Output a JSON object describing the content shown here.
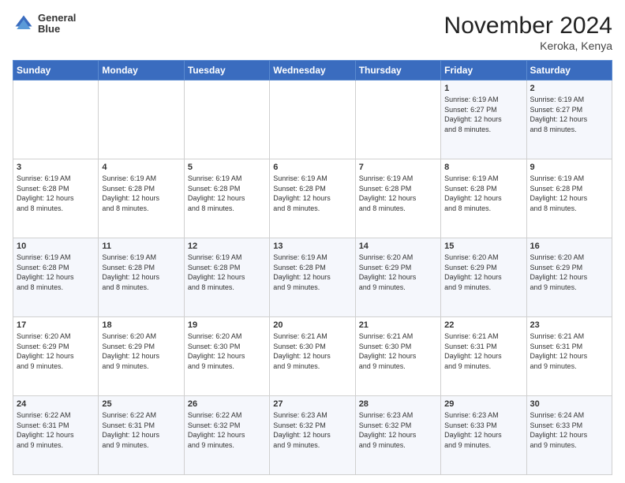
{
  "logo": {
    "line1": "General",
    "line2": "Blue"
  },
  "title": "November 2024",
  "location": "Keroka, Kenya",
  "days_of_week": [
    "Sunday",
    "Monday",
    "Tuesday",
    "Wednesday",
    "Thursday",
    "Friday",
    "Saturday"
  ],
  "weeks": [
    [
      {
        "day": "",
        "info": ""
      },
      {
        "day": "",
        "info": ""
      },
      {
        "day": "",
        "info": ""
      },
      {
        "day": "",
        "info": ""
      },
      {
        "day": "",
        "info": ""
      },
      {
        "day": "1",
        "info": "Sunrise: 6:19 AM\nSunset: 6:27 PM\nDaylight: 12 hours\nand 8 minutes."
      },
      {
        "day": "2",
        "info": "Sunrise: 6:19 AM\nSunset: 6:27 PM\nDaylight: 12 hours\nand 8 minutes."
      }
    ],
    [
      {
        "day": "3",
        "info": "Sunrise: 6:19 AM\nSunset: 6:28 PM\nDaylight: 12 hours\nand 8 minutes."
      },
      {
        "day": "4",
        "info": "Sunrise: 6:19 AM\nSunset: 6:28 PM\nDaylight: 12 hours\nand 8 minutes."
      },
      {
        "day": "5",
        "info": "Sunrise: 6:19 AM\nSunset: 6:28 PM\nDaylight: 12 hours\nand 8 minutes."
      },
      {
        "day": "6",
        "info": "Sunrise: 6:19 AM\nSunset: 6:28 PM\nDaylight: 12 hours\nand 8 minutes."
      },
      {
        "day": "7",
        "info": "Sunrise: 6:19 AM\nSunset: 6:28 PM\nDaylight: 12 hours\nand 8 minutes."
      },
      {
        "day": "8",
        "info": "Sunrise: 6:19 AM\nSunset: 6:28 PM\nDaylight: 12 hours\nand 8 minutes."
      },
      {
        "day": "9",
        "info": "Sunrise: 6:19 AM\nSunset: 6:28 PM\nDaylight: 12 hours\nand 8 minutes."
      }
    ],
    [
      {
        "day": "10",
        "info": "Sunrise: 6:19 AM\nSunset: 6:28 PM\nDaylight: 12 hours\nand 8 minutes."
      },
      {
        "day": "11",
        "info": "Sunrise: 6:19 AM\nSunset: 6:28 PM\nDaylight: 12 hours\nand 8 minutes."
      },
      {
        "day": "12",
        "info": "Sunrise: 6:19 AM\nSunset: 6:28 PM\nDaylight: 12 hours\nand 8 minutes."
      },
      {
        "day": "13",
        "info": "Sunrise: 6:19 AM\nSunset: 6:28 PM\nDaylight: 12 hours\nand 9 minutes."
      },
      {
        "day": "14",
        "info": "Sunrise: 6:20 AM\nSunset: 6:29 PM\nDaylight: 12 hours\nand 9 minutes."
      },
      {
        "day": "15",
        "info": "Sunrise: 6:20 AM\nSunset: 6:29 PM\nDaylight: 12 hours\nand 9 minutes."
      },
      {
        "day": "16",
        "info": "Sunrise: 6:20 AM\nSunset: 6:29 PM\nDaylight: 12 hours\nand 9 minutes."
      }
    ],
    [
      {
        "day": "17",
        "info": "Sunrise: 6:20 AM\nSunset: 6:29 PM\nDaylight: 12 hours\nand 9 minutes."
      },
      {
        "day": "18",
        "info": "Sunrise: 6:20 AM\nSunset: 6:29 PM\nDaylight: 12 hours\nand 9 minutes."
      },
      {
        "day": "19",
        "info": "Sunrise: 6:20 AM\nSunset: 6:30 PM\nDaylight: 12 hours\nand 9 minutes."
      },
      {
        "day": "20",
        "info": "Sunrise: 6:21 AM\nSunset: 6:30 PM\nDaylight: 12 hours\nand 9 minutes."
      },
      {
        "day": "21",
        "info": "Sunrise: 6:21 AM\nSunset: 6:30 PM\nDaylight: 12 hours\nand 9 minutes."
      },
      {
        "day": "22",
        "info": "Sunrise: 6:21 AM\nSunset: 6:31 PM\nDaylight: 12 hours\nand 9 minutes."
      },
      {
        "day": "23",
        "info": "Sunrise: 6:21 AM\nSunset: 6:31 PM\nDaylight: 12 hours\nand 9 minutes."
      }
    ],
    [
      {
        "day": "24",
        "info": "Sunrise: 6:22 AM\nSunset: 6:31 PM\nDaylight: 12 hours\nand 9 minutes."
      },
      {
        "day": "25",
        "info": "Sunrise: 6:22 AM\nSunset: 6:31 PM\nDaylight: 12 hours\nand 9 minutes."
      },
      {
        "day": "26",
        "info": "Sunrise: 6:22 AM\nSunset: 6:32 PM\nDaylight: 12 hours\nand 9 minutes."
      },
      {
        "day": "27",
        "info": "Sunrise: 6:23 AM\nSunset: 6:32 PM\nDaylight: 12 hours\nand 9 minutes."
      },
      {
        "day": "28",
        "info": "Sunrise: 6:23 AM\nSunset: 6:32 PM\nDaylight: 12 hours\nand 9 minutes."
      },
      {
        "day": "29",
        "info": "Sunrise: 6:23 AM\nSunset: 6:33 PM\nDaylight: 12 hours\nand 9 minutes."
      },
      {
        "day": "30",
        "info": "Sunrise: 6:24 AM\nSunset: 6:33 PM\nDaylight: 12 hours\nand 9 minutes."
      }
    ]
  ]
}
